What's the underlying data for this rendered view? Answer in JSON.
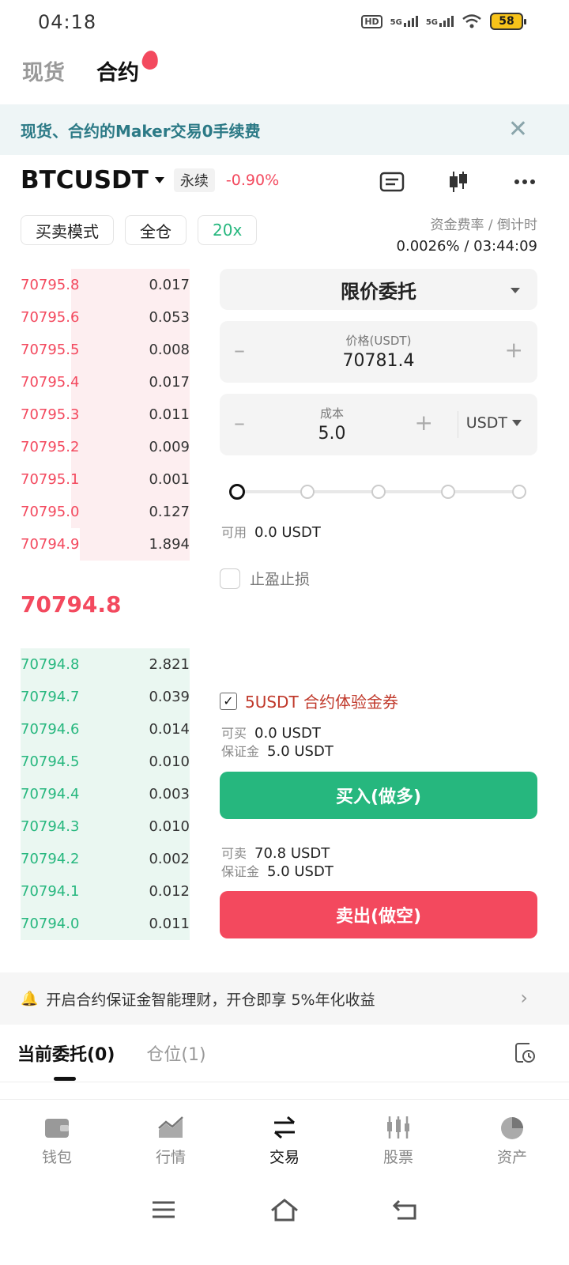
{
  "status_bar": {
    "time": "04:18",
    "network": "5G",
    "battery": "58"
  },
  "top_tabs": [
    {
      "label": "现货"
    },
    {
      "label": "合约"
    }
  ],
  "banner": {
    "text": "现货、合约的Maker交易0手续费",
    "close": "✕"
  },
  "pair": {
    "name": "BTCUSDT",
    "tag": "永续",
    "change": "-0.90%"
  },
  "modes": {
    "buy_sell": "买卖模式",
    "margin": "全仓",
    "leverage": "20x"
  },
  "funding": {
    "label": "资金费率 / 倒计时",
    "rate": "0.0026%",
    "sep": "/",
    "countdown": "03:44:09"
  },
  "asks": [
    {
      "price": "70795.8",
      "qty": "0.017",
      "depth": 0.7
    },
    {
      "price": "70795.6",
      "qty": "0.053",
      "depth": 0.7
    },
    {
      "price": "70795.5",
      "qty": "0.008",
      "depth": 0.7
    },
    {
      "price": "70795.4",
      "qty": "0.017",
      "depth": 0.7
    },
    {
      "price": "70795.3",
      "qty": "0.011",
      "depth": 0.7
    },
    {
      "price": "70795.2",
      "qty": "0.009",
      "depth": 0.7
    },
    {
      "price": "70795.1",
      "qty": "0.001",
      "depth": 0.7
    },
    {
      "price": "70795.0",
      "qty": "0.127",
      "depth": 0.7
    },
    {
      "price": "70794.9",
      "qty": "1.894",
      "depth": 0.65
    }
  ],
  "last_price": "70794.8",
  "bids": [
    {
      "price": "70794.8",
      "qty": "2.821",
      "depth": 1.0
    },
    {
      "price": "70794.7",
      "qty": "0.039",
      "depth": 1.0
    },
    {
      "price": "70794.6",
      "qty": "0.014",
      "depth": 1.0
    },
    {
      "price": "70794.5",
      "qty": "0.010",
      "depth": 1.0
    },
    {
      "price": "70794.4",
      "qty": "0.003",
      "depth": 1.0
    },
    {
      "price": "70794.3",
      "qty": "0.010",
      "depth": 1.0
    },
    {
      "price": "70794.2",
      "qty": "0.002",
      "depth": 1.0
    },
    {
      "price": "70794.1",
      "qty": "0.012",
      "depth": 1.0
    },
    {
      "price": "70794.0",
      "qty": "0.011",
      "depth": 1.0
    }
  ],
  "form": {
    "order_type": "限价委托",
    "price_label": "价格(USDT)",
    "price_value": "70781.4",
    "cost_label": "成本",
    "cost_value": "5.0",
    "cost_unit": "USDT",
    "minus": "–",
    "plus": "+",
    "slider_percent": 0,
    "available_label": "可用",
    "available_value": "0.0 USDT",
    "tpsl_label": "止盈止损",
    "coupon_label": "5USDT 合约体验金券",
    "can_buy_label": "可买",
    "can_buy_value": "0.0 USDT",
    "margin_label": "保证金",
    "margin_buy_value": "5.0 USDT",
    "buy_button": "买入(做多)",
    "can_sell_label": "可卖",
    "can_sell_value": "70.8 USDT",
    "margin_sell_value": "5.0 USDT",
    "sell_button": "卖出(做空)"
  },
  "promo": {
    "text": "开启合约保证金智能理财，开仓即享 5%年化收益",
    "chevron": "›"
  },
  "order_tabs": [
    {
      "label": "当前委托(0)"
    },
    {
      "label": "仓位(1)"
    }
  ],
  "bottom_nav": [
    {
      "label": "钱包",
      "icon": "wallet-icon"
    },
    {
      "label": "行情",
      "icon": "chart-icon"
    },
    {
      "label": "交易",
      "icon": "swap-icon"
    },
    {
      "label": "股票",
      "icon": "stocks-icon"
    },
    {
      "label": "资产",
      "icon": "pie-icon"
    }
  ],
  "colors": {
    "red": "#f3495e",
    "green": "#26b77e",
    "banner_text": "#2c7a86"
  }
}
